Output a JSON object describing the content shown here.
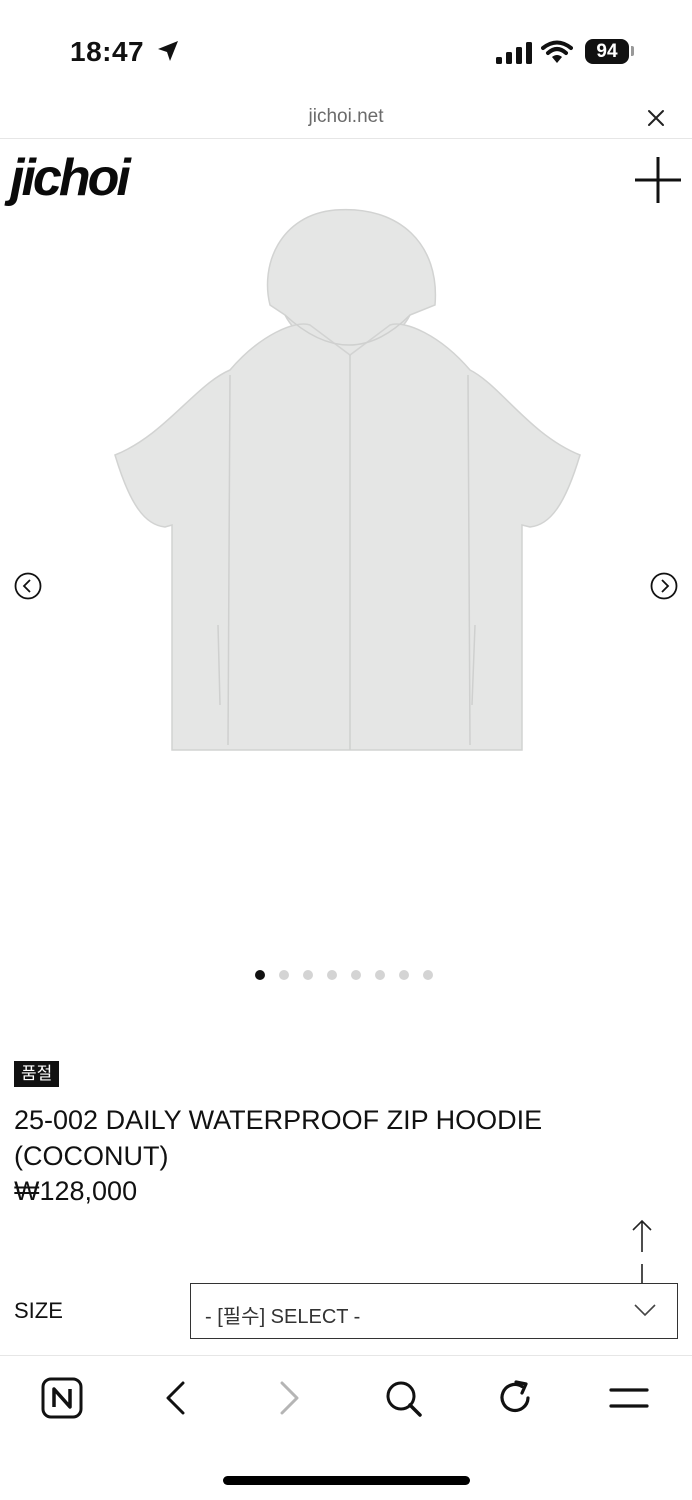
{
  "status_bar": {
    "time": "18:47",
    "battery": "94"
  },
  "browser": {
    "url": "jichoi.net"
  },
  "header": {
    "logo": "jichoi"
  },
  "carousel": {
    "slide_count": 8,
    "active_index": 0
  },
  "product": {
    "badge": "품절",
    "title": "25-002 DAILY WATERPROOF ZIP HOODIE (COCONUT)",
    "price": "₩128,000"
  },
  "options": {
    "size_label": "SIZE",
    "size_selected": "- [필수] SELECT -"
  },
  "toolbar": {
    "items": [
      "naver-home-icon",
      "back-icon",
      "forward-icon",
      "search-icon",
      "refresh-icon",
      "menu-icon"
    ]
  },
  "colors": {
    "accent": "#111111",
    "garment": "#e5e6e5"
  }
}
